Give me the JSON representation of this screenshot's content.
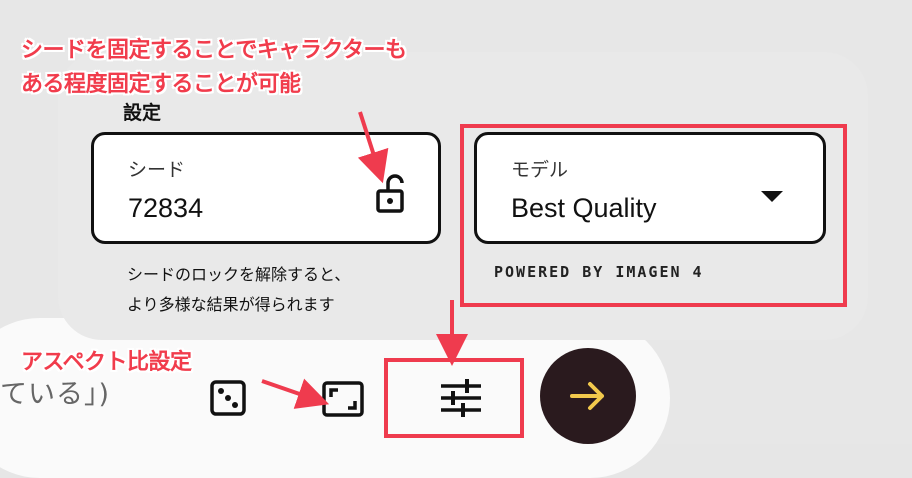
{
  "prompt": {
    "text_fragment": "ている」)"
  },
  "settings": {
    "title": "設定",
    "seed": {
      "label": "シード",
      "value": "72834",
      "icon": "unlock-icon"
    },
    "model": {
      "label": "モデル",
      "value": "Best Quality",
      "icon": "dropdown-arrow-icon"
    },
    "seed_help_line1": "シードのロックを解除すると、",
    "seed_help_line2": "より多様な結果が得られます",
    "powered_by": "POWERED BY IMAGEN 4"
  },
  "toolbar": {
    "dice_icon": "dice-icon",
    "aspect_icon": "aspect-ratio-icon",
    "tune_icon": "tune-icon",
    "submit_icon": "arrow-right-icon"
  },
  "annotations": {
    "seed_note_line1": "シードを固定することでキャラクターも",
    "seed_note_line2": "ある程度固定することが可能",
    "aspect_note": "アスペクト比設定",
    "color": "#ef3b4e"
  },
  "colors": {
    "submit_bg": "#2a1a1e",
    "submit_arrow": "#f2c94c",
    "panel_bg": "#e9e9e9"
  }
}
